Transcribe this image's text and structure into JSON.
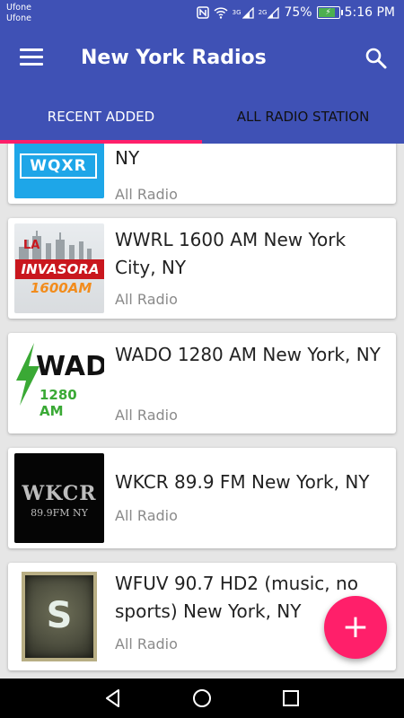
{
  "status": {
    "carrier_1": "Ufone",
    "carrier_2": "Ufone",
    "battery": "75%",
    "time": "5:16 PM",
    "signal_1": "3G",
    "signal_2": "2G"
  },
  "appbar": {
    "title": "New York Radios"
  },
  "tabs": [
    {
      "label": "RECENT ADDED",
      "active": true
    },
    {
      "label": "ALL RADIO STATION",
      "active": false
    }
  ],
  "stations": [
    {
      "logo_text": "WQXR",
      "title": "NY",
      "category": "All Radio"
    },
    {
      "logo_text_1": "LA",
      "logo_text_2": "INVASORA",
      "logo_text_3": "1600AM",
      "title": "WWRL 1600 AM New York City, NY",
      "category": "All Radio"
    },
    {
      "logo_text_1": "WAD",
      "logo_text_2": "1280 AM",
      "title": "WADO 1280 AM New York, NY",
      "category": "All Radio"
    },
    {
      "logo_text_1": "WKCR",
      "logo_text_2": "89.9FM NY",
      "title": "WKCR 89.9 FM New York, NY",
      "category": "All Radio"
    },
    {
      "logo_text": "S",
      "title": "WFUV 90.7 HD2 (music, no sports)  New York, NY",
      "category": "All Radio"
    }
  ],
  "fab": {
    "label": "+"
  },
  "colors": {
    "primary": "#3F51B5",
    "accent": "#FF1F6A"
  }
}
